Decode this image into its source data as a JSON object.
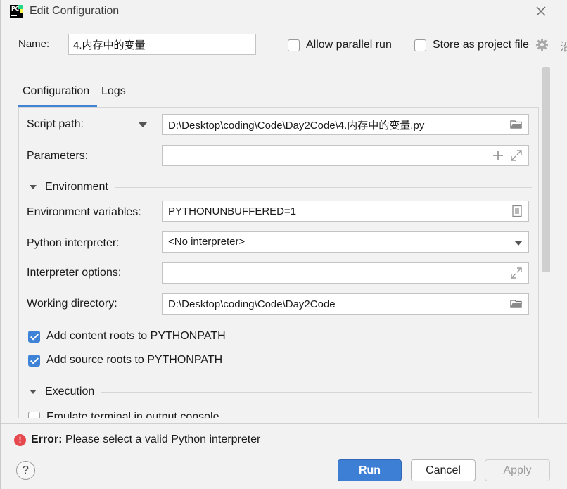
{
  "window": {
    "title": "Edit Configuration"
  },
  "header": {
    "name_label": "Name:",
    "name_value": "4.内存中的变量",
    "allow_parallel_label": "Allow parallel run",
    "allow_parallel_checked": false,
    "store_as_project_label": "Store as project file",
    "store_as_project_checked": false,
    "cut_char": "沿"
  },
  "tabs": [
    {
      "label": "Configuration",
      "active": true
    },
    {
      "label": "Logs",
      "active": false
    }
  ],
  "form": {
    "script_path_label": "Script path:",
    "script_path_value": "D:\\Desktop\\coding\\Code\\Day2Code\\4.内存中的变量.py",
    "parameters_label": "Parameters:",
    "parameters_value": "",
    "environment_section": "Environment",
    "env_vars_label": "Environment variables:",
    "env_vars_value": "PYTHONUNBUFFERED=1",
    "interpreter_label": "Python interpreter:",
    "interpreter_value": "<No interpreter>",
    "interpreter_options_label": "Interpreter options:",
    "interpreter_options_value": "",
    "working_dir_label": "Working directory:",
    "working_dir_value": "D:\\Desktop\\coding\\Code\\Day2Code",
    "add_content_roots_label": "Add content roots to PYTHONPATH",
    "add_content_roots_checked": true,
    "add_source_roots_label": "Add source roots to PYTHONPATH",
    "add_source_roots_checked": true,
    "execution_section": "Execution",
    "emulate_terminal_label": "Emulate terminal in output console"
  },
  "error": {
    "prefix": "Error:",
    "message": " Please select a valid Python interpreter"
  },
  "buttons": {
    "help": "?",
    "run": "Run",
    "cancel": "Cancel",
    "apply": "Apply"
  },
  "colors": {
    "accent": "#3e83d6",
    "error": "#e5484d"
  }
}
